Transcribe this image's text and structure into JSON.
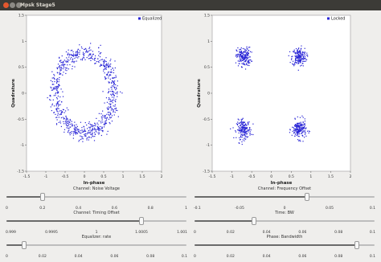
{
  "window": {
    "title": "Mpsk Stage5",
    "close_color": "#e4572e",
    "minimize_color": "#8c8a85",
    "maximize_color": "#8c8a85"
  },
  "plots": [
    {
      "legend": "Equalized",
      "xlabel": "In-phase",
      "ylabel": "Quadrature",
      "xticks": [
        "-1.5",
        "-1",
        "-0.5",
        "0",
        "0.5",
        "1",
        "1.5",
        "2"
      ],
      "yticks": [
        "1.5",
        "1",
        "0.5",
        "0",
        "-0.5",
        "-1",
        "-1.5"
      ],
      "marker_color": "#2a26d6",
      "shape": "ring"
    },
    {
      "legend": "Locked",
      "xlabel": "In-phase",
      "ylabel": "Quadrature",
      "xticks": [
        "-1.5",
        "-1",
        "-0.5",
        "0",
        "0.5",
        "1",
        "1.5",
        "2"
      ],
      "yticks": [
        "1.5",
        "1",
        "0.5",
        "0",
        "-0.5",
        "-1",
        "-1.5"
      ],
      "marker_color": "#2a26d6",
      "shape": "clusters"
    }
  ],
  "sliders": [
    {
      "label": "Channel: Noise Voltage",
      "value": 0.2,
      "min": 0,
      "max": 1,
      "ticks": [
        "0",
        "0.2",
        "0.4",
        "0.6",
        "0.8",
        "1"
      ]
    },
    {
      "label": "Channel: Frequency Offset",
      "value": 0.025,
      "min": -0.1,
      "max": 0.1,
      "ticks": [
        "-0.1",
        "-0.05",
        "0",
        "0.05",
        "0.1"
      ]
    },
    {
      "label": "Channel: Timing Offset",
      "value": 1.0005,
      "min": 0.999,
      "max": 1.001,
      "ticks": [
        "0.999",
        "0.9995",
        "1",
        "1.0005",
        "1.001"
      ]
    },
    {
      "label": "Time: BW",
      "value": 0.033,
      "min": 0,
      "max": 0.1,
      "ticks": [
        "0",
        "0.02",
        "0.04",
        "0.06",
        "0.08",
        "0.1"
      ]
    },
    {
      "label": "Equalizer: rate",
      "value": 0.01,
      "min": 0,
      "max": 0.1,
      "ticks": [
        "0",
        "0.02",
        "0.04",
        "0.06",
        "0.08",
        "0.1"
      ]
    },
    {
      "label": "Phase: Bandwidth",
      "value": 0.09,
      "min": 0,
      "max": 0.1,
      "ticks": [
        "0",
        "0.02",
        "0.04",
        "0.06",
        "0.08",
        "0.1"
      ]
    }
  ]
}
